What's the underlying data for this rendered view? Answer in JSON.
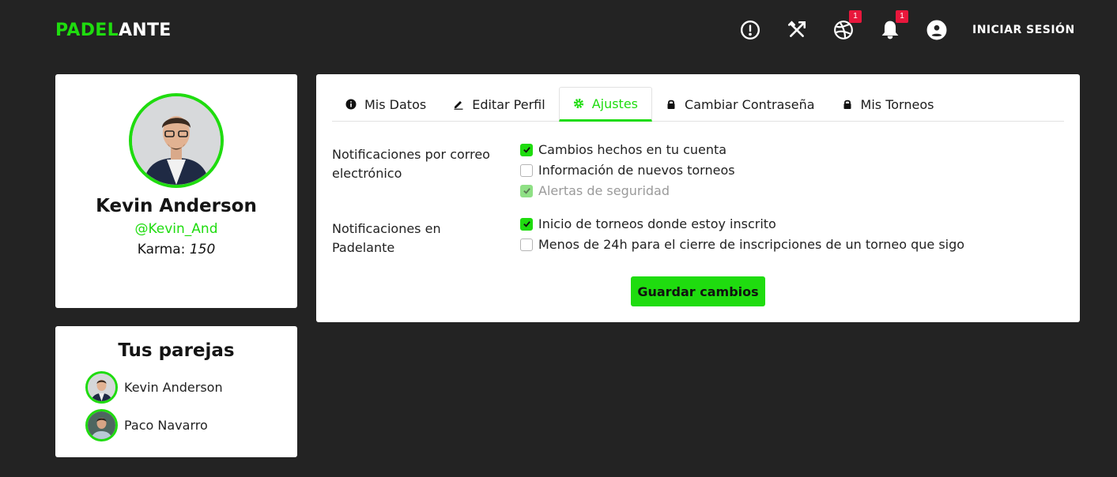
{
  "brand": {
    "part1": "PADEL",
    "part2": "ANTE",
    "accent": "#1fdc0f"
  },
  "nav": {
    "icons": [
      "alert-circle-icon",
      "tools-icon",
      "ball-icon",
      "bell-icon",
      "user-circle-icon"
    ],
    "ball_badge": "1",
    "bell_badge": "1",
    "login_label": "INICIAR SESIÓN"
  },
  "profile": {
    "name": "Kevin Anderson",
    "handle": "@Kevin_And",
    "karma_label": "Karma:",
    "karma_value": "150"
  },
  "pairs": {
    "title": "Tus parejas",
    "items": [
      {
        "name": "Kevin Anderson"
      },
      {
        "name": "Paco Navarro"
      }
    ]
  },
  "tabs": [
    {
      "label": "Mis Datos",
      "icon": "info-icon",
      "active": false
    },
    {
      "label": "Editar Perfil",
      "icon": "edit-icon",
      "active": false
    },
    {
      "label": "Ajustes",
      "icon": "gear-icon",
      "active": true
    },
    {
      "label": "Cambiar Contraseña",
      "icon": "lock-icon",
      "active": false
    },
    {
      "label": "Mis Torneos",
      "icon": "lock-icon",
      "active": false
    }
  ],
  "settings": {
    "email_group": {
      "label": "Notificaciones por correo electrónico",
      "options": [
        {
          "label": "Cambios hechos en tu cuenta",
          "checked": true,
          "disabled": false
        },
        {
          "label": "Información de nuevos torneos",
          "checked": false,
          "disabled": false
        },
        {
          "label": "Alertas de seguridad",
          "checked": true,
          "disabled": true
        }
      ]
    },
    "app_group": {
      "label": "Notificaciones en Padelante",
      "options": [
        {
          "label": "Inicio de torneos donde estoy inscrito",
          "checked": true,
          "disabled": false
        },
        {
          "label": "Menos de 24h para el cierre de inscripciones de un torneo que sigo",
          "checked": false,
          "disabled": false
        }
      ]
    },
    "save_label": "Guardar cambios"
  }
}
